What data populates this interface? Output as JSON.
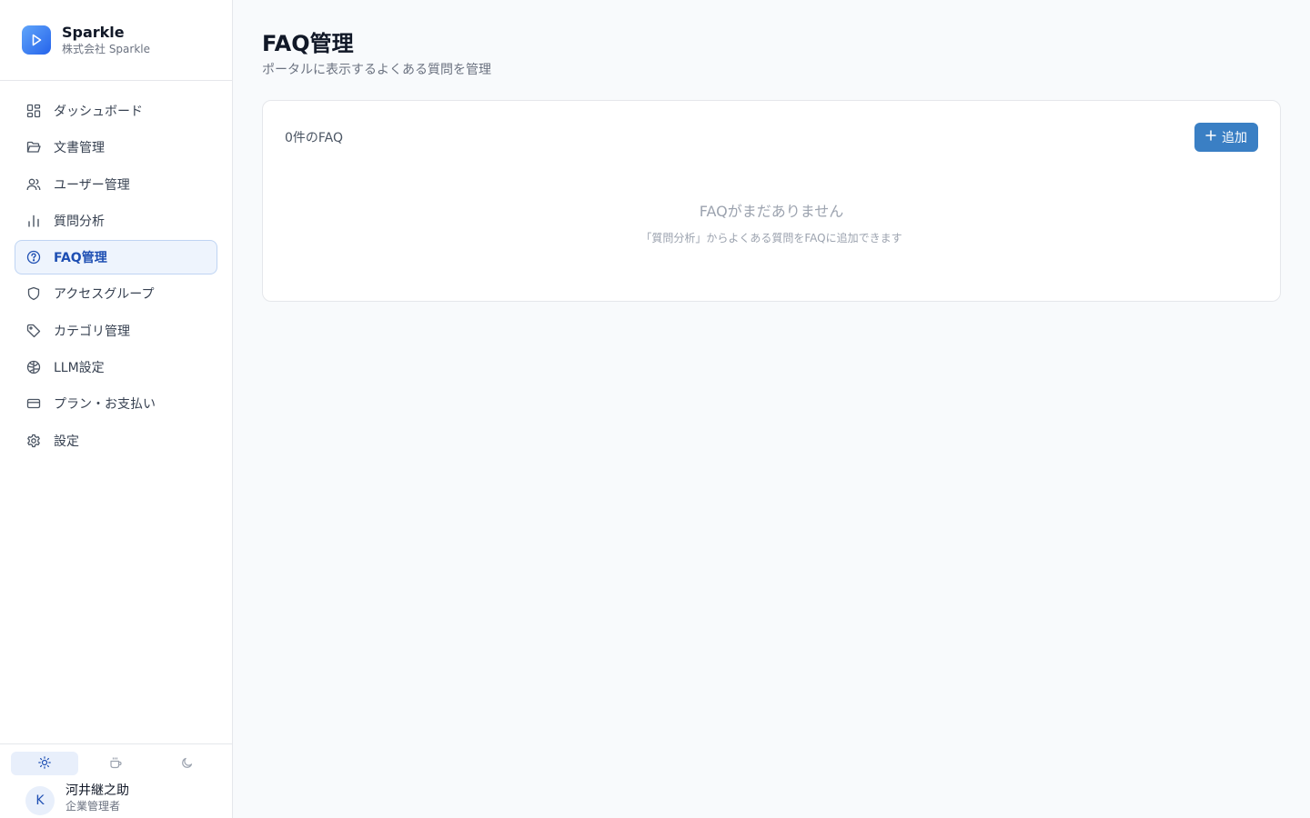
{
  "brand": {
    "name": "Sparkle",
    "company": "株式会社 Sparkle",
    "accent": "#3b82f6"
  },
  "sidebar": {
    "items": [
      {
        "label": "ダッシュボード",
        "icon": "dashboard-icon",
        "active": false
      },
      {
        "label": "文書管理",
        "icon": "folder-icon",
        "active": false
      },
      {
        "label": "ユーザー管理",
        "icon": "users-icon",
        "active": false
      },
      {
        "label": "質問分析",
        "icon": "bar-chart-icon",
        "active": false
      },
      {
        "label": "FAQ管理",
        "icon": "help-circle-icon",
        "active": true
      },
      {
        "label": "アクセスグループ",
        "icon": "shield-icon",
        "active": false
      },
      {
        "label": "カテゴリ管理",
        "icon": "tag-icon",
        "active": false
      },
      {
        "label": "LLM設定",
        "icon": "brain-icon",
        "active": false
      },
      {
        "label": "プラン・お支払い",
        "icon": "credit-card-icon",
        "active": false
      },
      {
        "label": "設定",
        "icon": "gear-icon",
        "active": false
      }
    ],
    "themes": [
      {
        "icon": "sun-icon",
        "active": true
      },
      {
        "icon": "coffee-icon",
        "active": false
      },
      {
        "icon": "moon-icon",
        "active": false
      }
    ],
    "user": {
      "initial": "K",
      "name": "河井継之助",
      "role": "企業管理者"
    }
  },
  "main": {
    "title": "FAQ管理",
    "subtitle": "ポータルに表示するよくある質問を管理",
    "count_label": "0件のFAQ",
    "add_label": "追加",
    "empty_title": "FAQがまだありません",
    "empty_desc": "「質問分析」からよくある質問をFAQに追加できます"
  },
  "colors": {
    "primary_button": "#3a7fc4",
    "active_nav_bg": "#eef4fd",
    "active_nav_text": "#1e4fb3"
  }
}
